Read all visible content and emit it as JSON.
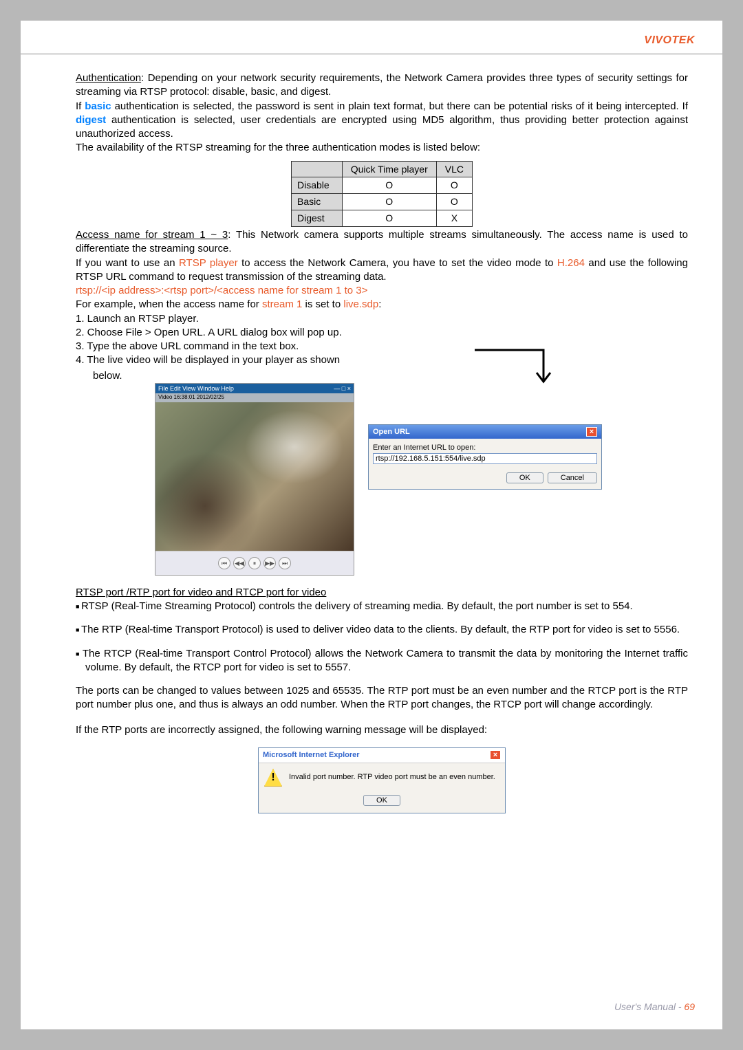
{
  "header": {
    "brand": "VIVOTEK"
  },
  "auth_section": {
    "heading": "Authentication",
    "intro": ": Depending on your network security requirements, the Network Camera provides three types of security settings for streaming via RTSP protocol: disable, basic, and digest.",
    "if_prefix": "If ",
    "basic": "basic",
    "basic_text": " authentication is selected, the password is sent in plain text format, but there can be potential risks of it being intercepted. If ",
    "digest": "digest",
    "digest_text": " authentication is selected, user credentials are encrypted using MD5 algorithm, thus providing better protection against unauthorized access.",
    "avail_text": "The availability of the RTSP streaming for the three authentication modes is listed below:"
  },
  "auth_table": {
    "col1": "Quick Time player",
    "col2": "VLC",
    "rows": [
      {
        "label": "Disable",
        "c1": "O",
        "c2": "O"
      },
      {
        "label": "Basic",
        "c1": "O",
        "c2": "O"
      },
      {
        "label": "Digest",
        "c1": "O",
        "c2": "X"
      }
    ]
  },
  "access": {
    "heading": "Access name for stream 1 ~ 3",
    "intro": ": This Network camera supports multiple streams simultaneously. The access name is used to differentiate the streaming source.",
    "line2_a": "If you want to use an ",
    "rtsp_player": "RTSP player",
    "line2_b": " to access the Network Camera, you have to set the video mode to ",
    "h264": "H.264",
    "line2_c": " and use the following RTSP URL command to request transmission of the streaming data.",
    "url_template": "rtsp://<ip address>:<rtsp port>/<access name for stream 1 to 3>",
    "example_a": "For example, when the access name for ",
    "stream1": "stream 1",
    "example_b": " is set to ",
    "live_sdp": "live.sdp",
    "example_c": ":",
    "steps": [
      "1. Launch an RTSP player.",
      "2. Choose File > Open URL. A URL dialog box will pop up.",
      "3. Type the above URL command in the text box.",
      "4. The live video will be displayed in your player as shown"
    ],
    "step4_below": "below."
  },
  "video": {
    "title": "File  Edit  View  Window  Help",
    "timestamp": "Video 16:38:01 2012/02/25"
  },
  "url_dialog": {
    "title": "Open URL",
    "label": "Enter an Internet URL to open:",
    "value": "rtsp://192.168.5.151:554/live.sdp",
    "ok": "OK",
    "cancel": "Cancel"
  },
  "ports_section": {
    "heading": "RTSP port /RTP port for video and RTCP port for video",
    "bullets": [
      "RTSP (Real-Time Streaming Protocol) controls the delivery of streaming media. By default, the port number is set to 554.",
      "The RTP (Real-time Transport Protocol) is used to deliver video data to the clients. By default, the RTP port for video is set to 5556.",
      "The RTCP (Real-time Transport Control Protocol) allows the Network Camera to transmit the data by monitoring the Internet traffic volume. By default, the RTCP port for video is set to 5557."
    ],
    "para1": "The ports can be changed to values between 1025 and 65535. The RTP port must be an even number and the RTCP port is the RTP port number plus one, and thus is always an odd number. When the RTP port changes, the RTCP port will change accordingly.",
    "para2": "If the RTP ports are incorrectly assigned, the following warning message will be displayed:"
  },
  "ie_dialog": {
    "title": "Microsoft Internet Explorer",
    "msg": "Invalid port number. RTP video port must be an even number.",
    "ok": "OK"
  },
  "footer": {
    "text": "User's Manual - ",
    "page": "69"
  }
}
